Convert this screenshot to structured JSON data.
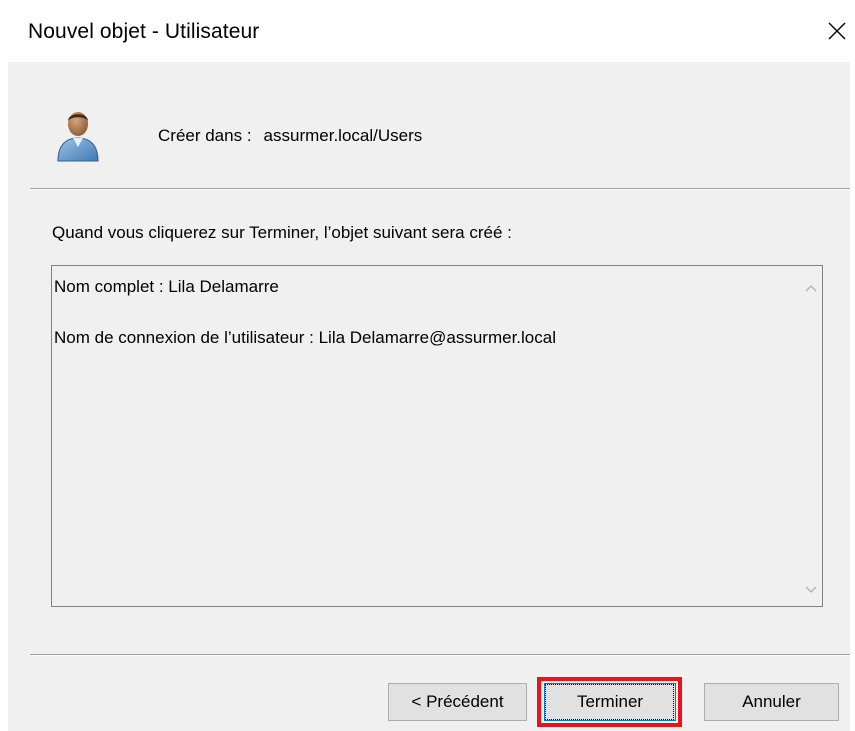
{
  "window": {
    "title": "Nouvel objet - Utilisateur",
    "close_glyph": "✕"
  },
  "header": {
    "icon": "user-icon",
    "create_in_label": "Créer dans :",
    "create_in_path": "assurmer.local/Users"
  },
  "main": {
    "info_text": "Quand vous cliquerez sur Terminer, l’objet suivant sera créé :",
    "summary_lines": [
      "Nom complet : Lila Delamarre",
      "Nom de connexion de l’utilisateur : Lila Delamarre@assurmer.local"
    ]
  },
  "buttons": {
    "previous": "< Précédent",
    "finish": "Terminer",
    "cancel": "Annuler"
  },
  "colors": {
    "highlight": "#e8141c",
    "dialog_bg": "#f0f0f0",
    "focus_border": "#0078d7"
  }
}
